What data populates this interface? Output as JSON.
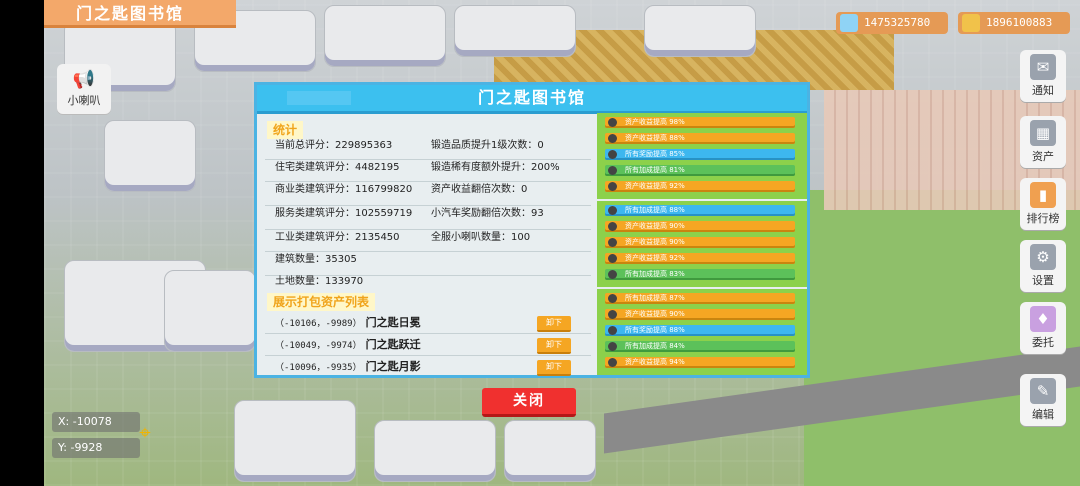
{
  "header": {
    "title": "门之匙图书馆"
  },
  "resources": [
    {
      "icon": "diamond-icon",
      "value": "1475325780"
    },
    {
      "icon": "coin-icon",
      "value": "1896100883"
    }
  ],
  "speaker": {
    "label": "小喇叭"
  },
  "sidebar": [
    {
      "icon": "notice-icon",
      "label": "通知"
    },
    {
      "icon": "asset-icon",
      "label": "资产"
    },
    {
      "icon": "ranking-icon",
      "label": "排行榜"
    },
    {
      "icon": "settings-icon",
      "label": "设置"
    },
    {
      "icon": "commission-icon",
      "label": "委托"
    },
    {
      "icon": "edit-icon",
      "label": "编辑"
    }
  ],
  "coords": {
    "x_label": "X:",
    "x": "-10078",
    "y_label": "Y:",
    "y": "-9928"
  },
  "dialog": {
    "title": "门之匙图书馆",
    "stats_label": "统计",
    "stats": [
      {
        "label": "当前总评分：",
        "value": "229895363"
      },
      {
        "label": "锻造品质提升1级次数：",
        "value": "0"
      },
      {
        "label": "住宅类建筑评分：",
        "value": "4482195"
      },
      {
        "label": "锻造稀有度额外提升：",
        "value": "200%"
      },
      {
        "label": "商业类建筑评分：",
        "value": "116799820"
      },
      {
        "label": "资产收益翻倍次数：",
        "value": "0"
      },
      {
        "label": "服务类建筑评分：",
        "value": "102559719"
      },
      {
        "label": "小汽车奖励翻倍次数：",
        "value": "93"
      },
      {
        "label": "工业类建筑评分：",
        "value": "2135450"
      },
      {
        "label": "全服小喇叭数量：",
        "value": "100"
      },
      {
        "label": "建筑数量：",
        "value": "35305"
      },
      {
        "label": "土地数量：",
        "value": "133970"
      }
    ],
    "assets_label": "展示打包资产列表",
    "assets": [
      {
        "coords": "（-10106，-9989）",
        "name": "门之匙日冕",
        "button": "卸下"
      },
      {
        "coords": "（-10049，-9974）",
        "name": "门之匙跃迁",
        "button": "卸下"
      },
      {
        "coords": "（-10096，-9935）",
        "name": "门之匙月影",
        "button": "卸下"
      }
    ],
    "bonus_groups": [
      {
        "items": [
          {
            "color": "orange",
            "text": "资产收益提高 98%"
          },
          {
            "color": "orange",
            "text": "资产收益提高 88%"
          },
          {
            "color": "blue",
            "text": "所有奖励提高 85%"
          },
          {
            "color": "green",
            "text": "所有加成提高 81%"
          },
          {
            "color": "orange",
            "text": "资产收益提高 92%"
          }
        ]
      },
      {
        "items": [
          {
            "color": "blue",
            "text": "所有加成提高 88%"
          },
          {
            "color": "orange",
            "text": "资产收益提高 90%"
          },
          {
            "color": "orange",
            "text": "资产收益提高 90%"
          },
          {
            "color": "orange",
            "text": "资产收益提高 92%"
          },
          {
            "color": "green",
            "text": "所有加成提高 83%"
          }
        ]
      },
      {
        "items": [
          {
            "color": "orange",
            "text": "所有加成提高 87%"
          },
          {
            "color": "orange",
            "text": "资产收益提高 90%"
          },
          {
            "color": "blue",
            "text": "所有奖励提高 88%"
          },
          {
            "color": "green",
            "text": "所有加成提高 84%"
          },
          {
            "color": "orange",
            "text": "资产收益提高 94%"
          }
        ]
      }
    ],
    "close_label": "关闭"
  }
}
